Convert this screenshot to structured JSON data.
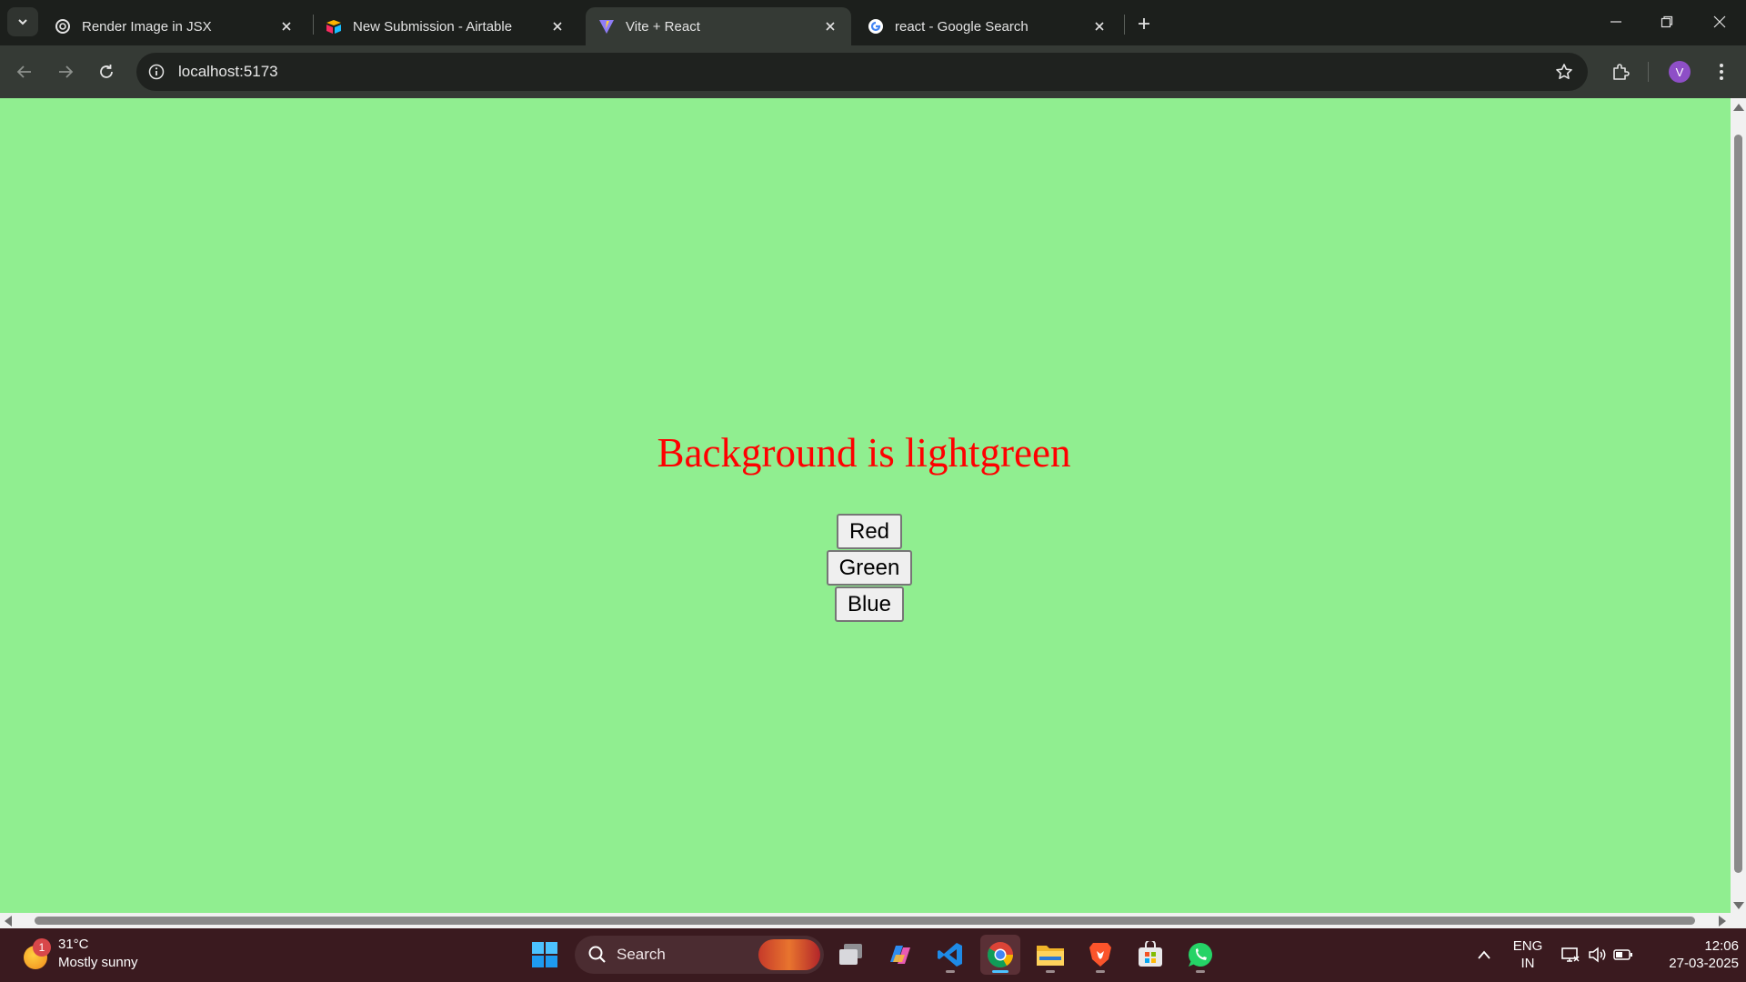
{
  "browser": {
    "tabs": [
      {
        "title": "Render Image in JSX",
        "icon": "openai-icon",
        "active": false
      },
      {
        "title": "New Submission - Airtable",
        "icon": "airtable-icon",
        "active": false
      },
      {
        "title": "Vite + React",
        "icon": "vite-icon",
        "active": true
      },
      {
        "title": "react - Google Search",
        "icon": "google-icon",
        "active": false
      }
    ],
    "url": "localhost:5173",
    "profile_initial": "V"
  },
  "page": {
    "background_color": "#90ee90",
    "heading_color": "#ff0000",
    "heading": "Background is lightgreen",
    "buttons": [
      "Red",
      "Green",
      "Blue"
    ]
  },
  "taskbar": {
    "weather": {
      "temp": "31°C",
      "condition": "Mostly sunny",
      "badge": "1"
    },
    "search_label": "Search",
    "language": {
      "line1": "ENG",
      "line2": "IN"
    },
    "time": "12:06",
    "date": "27-03-2025",
    "accent": "#4cc2ff"
  }
}
